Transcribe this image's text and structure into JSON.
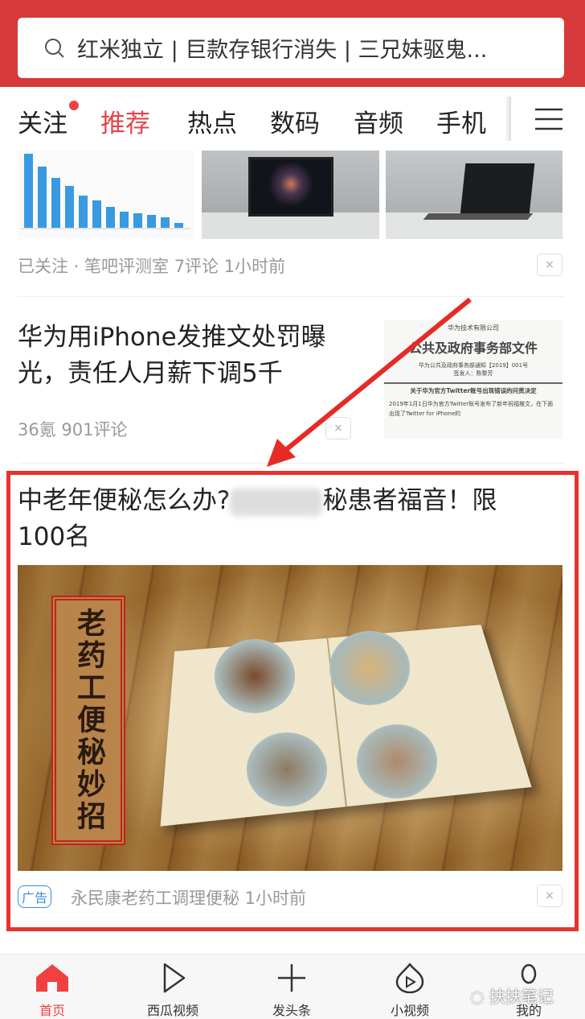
{
  "search": {
    "placeholder": "红米独立 | 巨款存银行消失 | 三兄妹驱鬼...",
    "icon": "search-icon"
  },
  "tabs": [
    {
      "label": "关注",
      "badge": true
    },
    {
      "label": "推荐",
      "active": true
    },
    {
      "label": "热点"
    },
    {
      "label": "数码"
    },
    {
      "label": "音频"
    },
    {
      "label": "手机"
    }
  ],
  "menu_icon": "hamburger-icon",
  "accent": "#e0454a",
  "feed": [
    {
      "meta": "已关注 · 笔吧评测室  7评论  1小时前"
    },
    {
      "title_line1": "华为用iPhone发推文处罚曝",
      "title_line2": "光，责任人月薪下调5千",
      "meta": "36氪  901评论",
      "thumb": {
        "org": "华为技术有限公司",
        "heading": "公共及政府事务部文件",
        "line1": "华为公共及政府事务部通知【2019】001号",
        "line2": "签发人：陈黎芳",
        "subject": "关于华为官方Twitter账号出现错误的问责决定",
        "body": "2019年1月1日华为官方Twitter账号发布了新年祝福推文，在下面出现了Twitter for iPhone的"
      }
    },
    {
      "title_line1": "中老年便秘怎么办?",
      "title_blurred": "",
      "title_tail": "秘患者福音！限",
      "title_line2": "100名",
      "image_text": "老药工便秘妙招",
      "ad_label": "广告",
      "meta": "永民康老药工调理便秘  1小时前"
    }
  ],
  "close_label": "×",
  "bottom_nav": [
    {
      "label": "首页",
      "icon": "home-icon",
      "active": true
    },
    {
      "label": "西瓜视频",
      "icon": "play-icon"
    },
    {
      "label": "发头条",
      "icon": "plus-icon"
    },
    {
      "label": "小视频",
      "icon": "flame-play-icon"
    },
    {
      "label": "我的",
      "icon": "user-icon"
    }
  ],
  "watermark": "扶扶笔记"
}
